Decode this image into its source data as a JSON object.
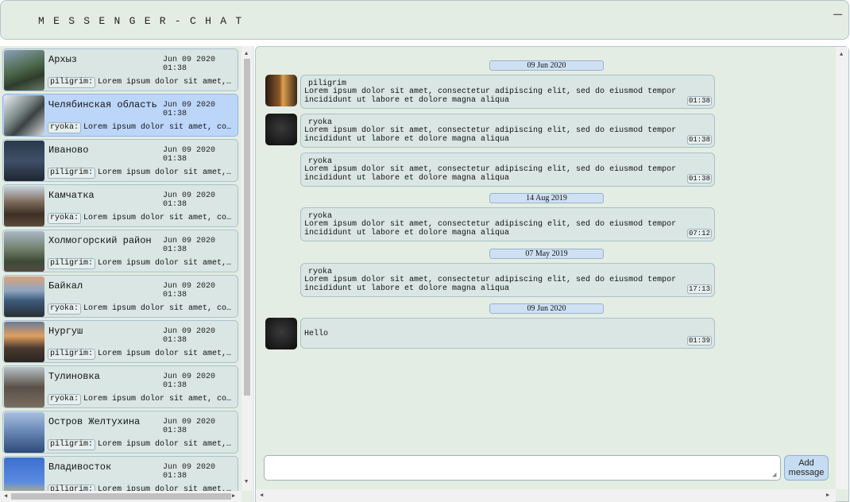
{
  "header": {
    "title": "MESSENGER-CHAT",
    "minimize_icon": "—"
  },
  "chats": [
    {
      "name": "Архыз",
      "date": "Jun 09 2020 01:38",
      "author": "piligrim:",
      "preview": "Lorem ipsum dolor sit amet,…",
      "active": false,
      "thumb": "linear-gradient(160deg,#8aa0b8 0%,#4f6a4f 45%,#2e3d2a 70%,#6a7a6a 100%)"
    },
    {
      "name": "Челябинская область",
      "date": "Jun 09 2020 01:38",
      "author": "ryoka:",
      "preview": "Lorem ipsum dolor sit amet, co…",
      "active": true,
      "thumb": "linear-gradient(135deg,#e8eef2 0%,#7e8a8a 40%,#3b4242 60%,#d6dde0 100%)"
    },
    {
      "name": "Иваново",
      "date": "Jun 09 2020 01:38",
      "author": "piligrim:",
      "preview": "Lorem ipsum dolor sit amet,…",
      "active": false,
      "thumb": "linear-gradient(180deg,#2a3a4a 0%,#3e5068 50%,#1e2530 100%)"
    },
    {
      "name": "Камчатка",
      "date": "Jun 09 2020 01:38",
      "author": "ryoka:",
      "preview": "Lorem ipsum dolor sit amet, co…",
      "active": false,
      "thumb": "linear-gradient(180deg,#c8d4e0 0%,#7d6b5b 40%,#3e3026 70%,#5a4a3a 100%)"
    },
    {
      "name": "Холмогорский район",
      "date": "Jun 09 2020 01:38",
      "author": "piligrim:",
      "preview": "Lorem ipsum dolor sit amet,…",
      "active": false,
      "thumb": "linear-gradient(180deg,#aab8c6 0%,#6e7f6a 45%,#3d4a36 75%,#524a40 100%)"
    },
    {
      "name": "Байкал",
      "date": "Jun 09 2020 01:38",
      "author": "ryoka:",
      "preview": "Lorem ipsum dolor sit amet, co…",
      "active": false,
      "thumb": "linear-gradient(180deg,#d9a37a 0%,#8fa6c2 35%,#3c5a7a 60%,#2a2f36 100%)"
    },
    {
      "name": "Нургуш",
      "date": "Jun 09 2020 01:38",
      "author": "piligrim:",
      "preview": "Lorem ipsum dolor sit amet,…",
      "active": false,
      "thumb": "linear-gradient(180deg,#6a7a96 0%,#e0a060 35%,#4a3a2e 65%,#2a2622 100%)"
    },
    {
      "name": "Тулиновка",
      "date": "Jun 09 2020 01:38",
      "author": "ryoka:",
      "preview": "Lorem ipsum dolor sit amet, co…",
      "active": false,
      "thumb": "linear-gradient(180deg,#b8c2c8 0%,#5a5048 50%,#7a6e60 100%)"
    },
    {
      "name": "Остров Желтухина",
      "date": "Jun 09 2020 01:38",
      "author": "piligrim:",
      "preview": "Lorem ipsum dolor sit amet,…",
      "active": false,
      "thumb": "linear-gradient(180deg,#a8c0e0 0%,#6a8ab8 45%,#2e4a78 100%)"
    },
    {
      "name": "Владивосток",
      "date": "Jun 09 2020 01:38",
      "author": "piligrim:",
      "preview": "Lorem ipsum dolor sit amet,…",
      "active": false,
      "thumb": "linear-gradient(180deg,#3b6fd0 0%,#5a8ae0 60%,#d4c060 100%)"
    }
  ],
  "conversation": {
    "separators": [
      "09 Jun 2020",
      "14 Aug 2019",
      "07 May 2019",
      "09 Jun 2020"
    ],
    "messages": [
      {
        "author": "piligrim",
        "text": "Lorem ipsum dolor sit amet, consectetur adipiscing elit, sed do eiusmod tempor incididunt ut labore et dolore magna aliqua",
        "time": "01:38",
        "avatar": "linear-gradient(90deg,#2a1a10 0%,#8a5a2a 45%,#e0a050 55%,#3a2616 100%)",
        "show_avatar": true
      },
      {
        "author": "ryoka",
        "text": "Lorem ipsum dolor sit amet, consectetur adipiscing elit, sed do eiusmod tempor incididunt ut labore et dolore magna aliqua",
        "time": "01:38",
        "avatar": "radial-gradient(circle at 50% 45%,#3a3a3a 0%,#1a1a1a 70%,#0e0e0e 100%)",
        "show_avatar": true
      },
      {
        "author": "ryoka",
        "text": "Lorem ipsum dolor sit amet, consectetur adipiscing elit, sed do eiusmod tempor incididunt ut labore et dolore magna aliqua",
        "time": "01:38",
        "avatar": "",
        "show_avatar": false
      },
      {
        "author": "ryoka",
        "text": "Lorem ipsum dolor sit amet, consectetur adipiscing elit, sed do eiusmod tempor incididunt ut labore et dolore magna aliqua",
        "time": "07:12",
        "avatar": "",
        "show_avatar": false
      },
      {
        "author": "ryoka",
        "text": "Lorem ipsum dolor sit amet, consectetur adipiscing elit, sed do eiusmod tempor incididunt ut labore et dolore magna aliqua",
        "time": "17:13",
        "avatar": "",
        "show_avatar": false
      },
      {
        "author": "",
        "text": "Hello",
        "time": "01:39",
        "avatar": "radial-gradient(circle at 50% 45%,#3a3a3a 0%,#1a1a1a 70%,#0e0e0e 100%)",
        "show_avatar": true
      }
    ]
  },
  "composer": {
    "value": "",
    "add_button_line1": "Add",
    "add_button_line2": "message"
  }
}
